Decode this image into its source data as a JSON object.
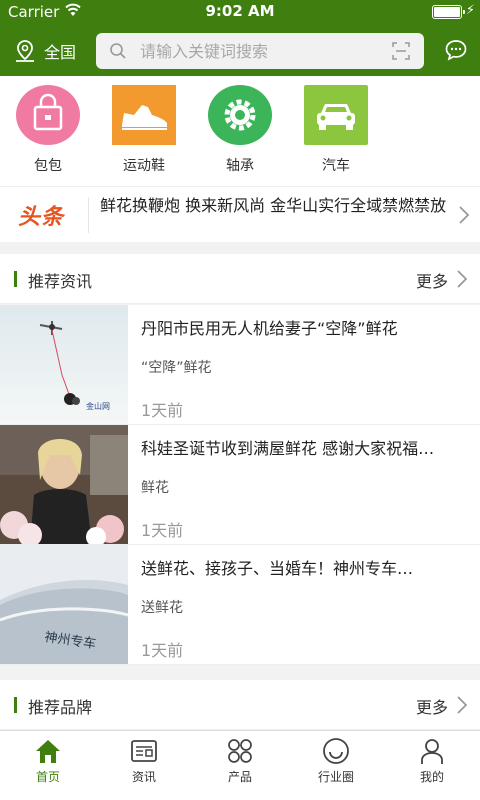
{
  "status_bar": {
    "carrier": "Carrier",
    "time": "9:02 AM"
  },
  "header": {
    "location": "全国",
    "search_placeholder": "请输入关键词搜索"
  },
  "categories": [
    {
      "label": "包包",
      "icon": "bag-icon",
      "color": "#f07aa1"
    },
    {
      "label": "运动鞋",
      "icon": "shoe-icon",
      "color": "#f29a2e"
    },
    {
      "label": "轴承",
      "icon": "gear-icon",
      "color": "#3cb45a"
    },
    {
      "label": "汽车",
      "icon": "car-icon",
      "color": "#8cc63f"
    }
  ],
  "headline": {
    "logo": "头条",
    "text": "鲜花换鞭炮 换来新风尚 金华山实行全域禁燃禁放"
  },
  "news_section": {
    "title": "推荐资讯",
    "more": "更多"
  },
  "news": [
    {
      "title": "丹阳市民用无人机给妻子“空降”鲜花",
      "tag": "“空降”鲜花",
      "time": "1天前",
      "watermark": "金山网"
    },
    {
      "title": "科娃圣诞节收到满屋鲜花 感谢大家祝福…",
      "tag": "鲜花",
      "time": "1天前"
    },
    {
      "title": "送鲜花、接孩子、当婚车！神州专车…",
      "tag": "送鲜花",
      "time": "1天前",
      "watermark": "神州专车"
    }
  ],
  "brand_section": {
    "title": "推荐品牌",
    "more": "更多"
  },
  "tabs": [
    {
      "label": "首页",
      "icon": "home-icon",
      "active": true
    },
    {
      "label": "资讯",
      "icon": "news-icon",
      "active": false
    },
    {
      "label": "产品",
      "icon": "grid-icon",
      "active": false
    },
    {
      "label": "行业圈",
      "icon": "smile-icon",
      "active": false
    },
    {
      "label": "我的",
      "icon": "person-icon",
      "active": false
    }
  ],
  "colors": {
    "brand_green": "#3f7f10",
    "headline_orange": "#e8531f"
  }
}
